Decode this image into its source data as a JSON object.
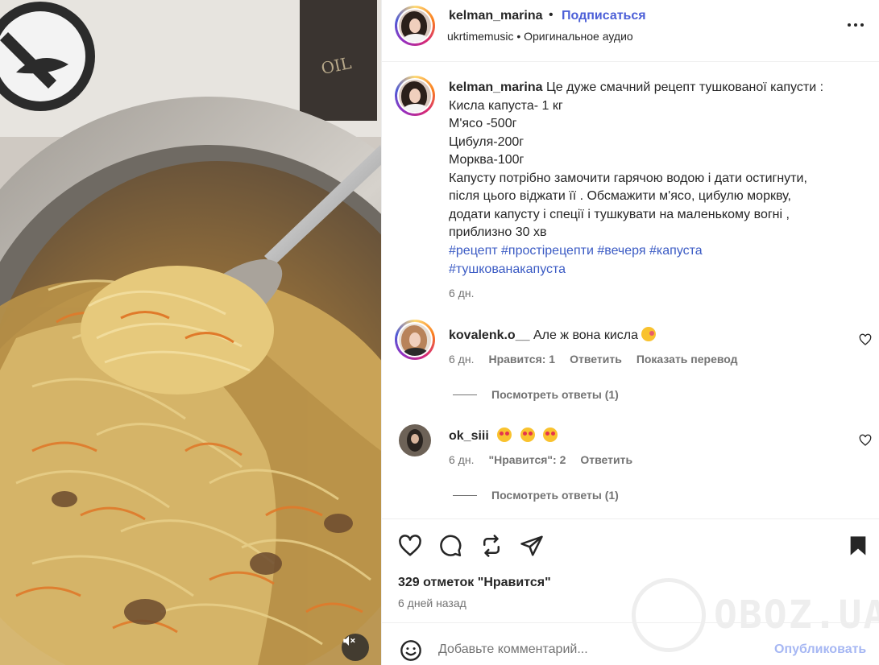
{
  "header": {
    "username": "kelman_marina",
    "dot": "•",
    "follow_label": "Подписаться",
    "audio_text": "ukrtimemusic • Оригинальное аудио"
  },
  "caption": {
    "username": "kelman_marina",
    "lines": [
      "Це дуже смачний рецепт тушкованої капусти :",
      "Кисла капуста- 1 кг",
      "М'ясо -500г",
      "Цибуля-200г",
      "Морква-100г",
      "Капусту потрібно замочити гарячою водою і дати остигнути,",
      "після цього віджати її . Обсмажити м'ясо, цибулю моркву,",
      "додати капусту і спеції і тушкувати на маленькому вогні ,",
      "приблизно 30 хв"
    ],
    "hashtags": [
      "#рецепт",
      "#простірецепти",
      "#вечеря",
      "#капуста",
      "#тушкованакапуста"
    ],
    "time": "6 дн."
  },
  "comments": [
    {
      "username": "kovalenk.o__",
      "text": "Але ж вона кисла",
      "time": "6 дн.",
      "likes": "Нравится: 1",
      "reply": "Ответить",
      "translate": "Показать перевод",
      "view_replies": "Посмотреть ответы (1)"
    },
    {
      "username": "ok_siii",
      "text": "",
      "time": "6 дн.",
      "likes": "\"Нравится\": 2",
      "reply": "Ответить",
      "view_replies": "Посмотреть ответы (1)"
    }
  ],
  "actions": {
    "likes_text": "329 отметок \"Нравится\"",
    "post_time": "6 дней назад"
  },
  "comment_box": {
    "placeholder": "Добавьте комментарий...",
    "publish_label": "Опубликовать"
  },
  "watermark": {
    "text": "OBOZ.UA"
  },
  "colors": {
    "link": "#4c5fd7",
    "hashtag": "#3b5bc4",
    "muted": "#737373",
    "publish_disabled": "#a6b7f3"
  },
  "icons": [
    "mute-icon",
    "more-options-icon",
    "heart-icon",
    "comment-icon",
    "repost-icon",
    "share-icon",
    "bookmark-icon",
    "emoji-icon"
  ]
}
